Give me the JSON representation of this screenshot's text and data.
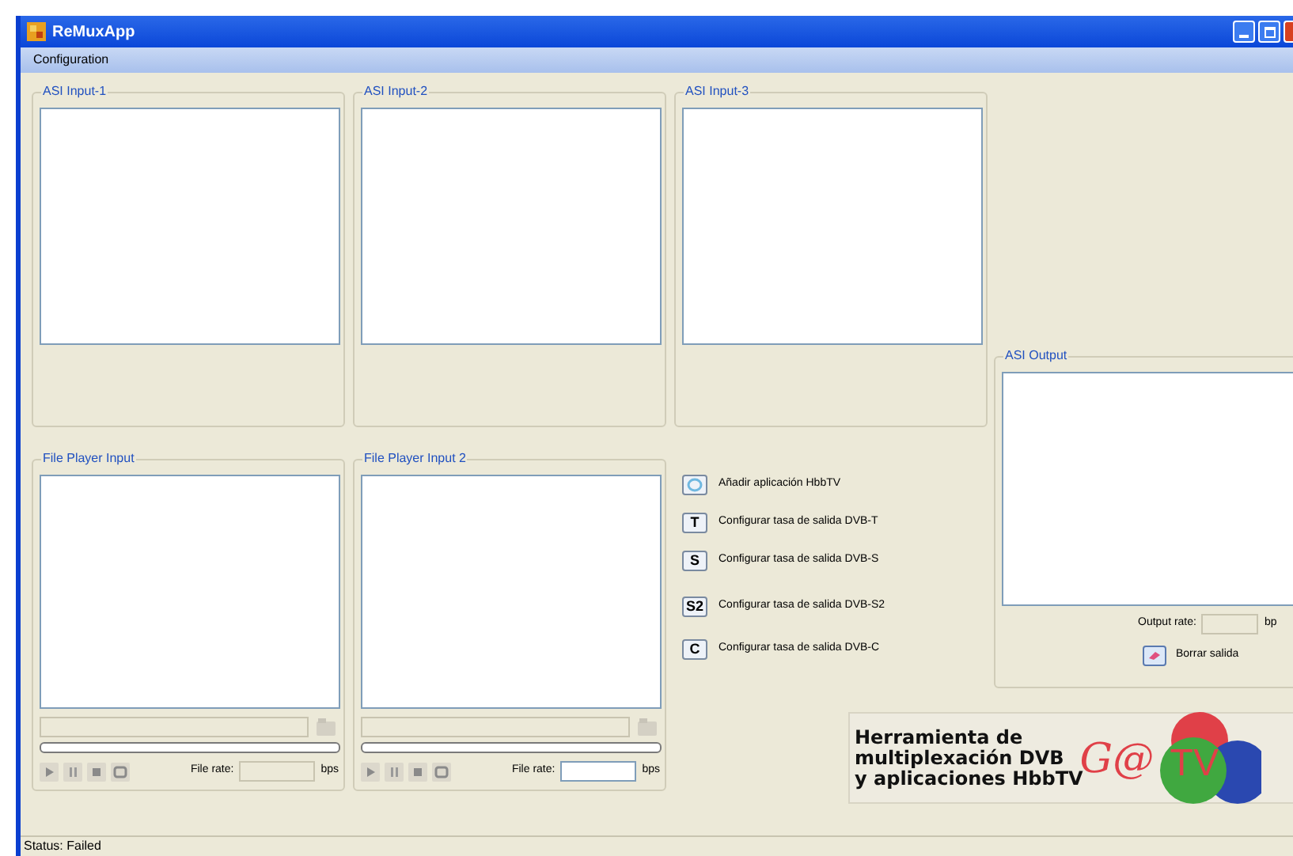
{
  "window": {
    "title": "ReMuxApp"
  },
  "menu": [
    "Configuration"
  ],
  "asi_inputs": [
    {
      "title": "ASI Input-1"
    },
    {
      "title": "ASI Input-2"
    },
    {
      "title": "ASI Input-3"
    }
  ],
  "file_players": [
    {
      "title": "File Player Input",
      "file_rate_label": "File rate:",
      "unit": "bps",
      "rate_disabled": true
    },
    {
      "title": "File Player Input 2",
      "file_rate_label": "File rate:",
      "unit": "bps",
      "rate_disabled": false
    }
  ],
  "actions": [
    {
      "kind": "hbbtv",
      "label": "Añadir aplicación HbbTV"
    },
    {
      "kind": "rate",
      "key": "T",
      "label": "Configurar tasa de salida DVB-T"
    },
    {
      "kind": "rate",
      "key": "S",
      "label": "Configurar tasa de salida DVB-S"
    },
    {
      "kind": "rate",
      "key": "S2",
      "label": "Configurar tasa de salida DVB-S2"
    },
    {
      "kind": "rate",
      "key": "C",
      "label": "Configurar tasa de salida DVB-C"
    }
  ],
  "asi_output": {
    "title": "ASI Output",
    "output_rate_label": "Output rate:",
    "unit": "bp",
    "clear_button": "Borrar salida"
  },
  "logo": {
    "lines": [
      "Herramienta de",
      "multiplexación DVB",
      "y aplicaciones HbbTV"
    ],
    "mark": "G@",
    "mark_circle": "TV"
  },
  "status_bar": "Status: Failed"
}
